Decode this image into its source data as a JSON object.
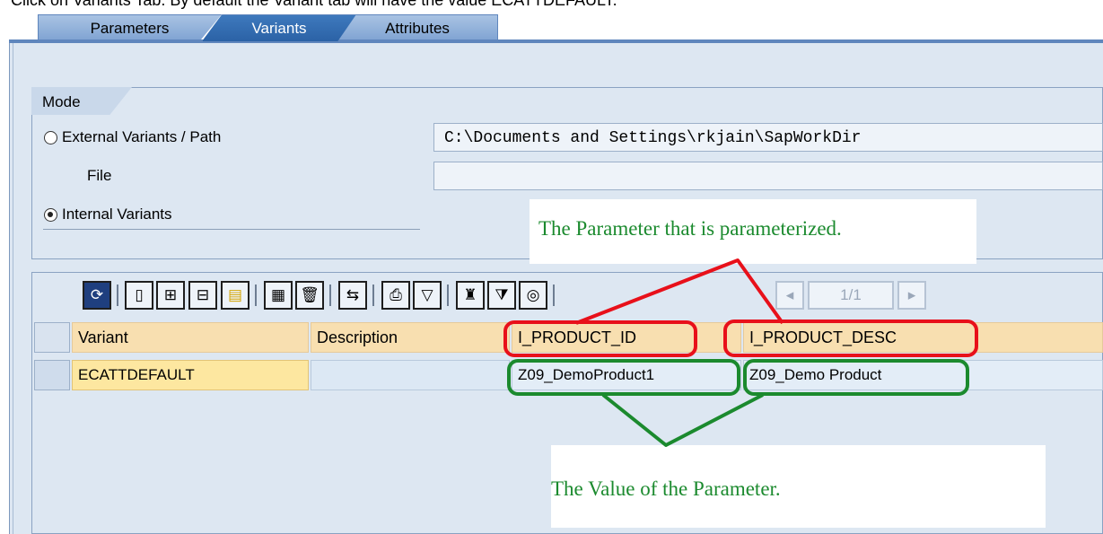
{
  "caption": "Click on Variants Tab. By default the Variant tab will have the value ECATTDEFAULT.",
  "tabs": [
    {
      "label": "Parameters"
    },
    {
      "label": "Variants"
    },
    {
      "label": "Attributes"
    }
  ],
  "mode": {
    "title": "Mode",
    "external_label": "External Variants / Path",
    "path_value": "C:\\Documents and Settings\\rkjain\\SapWorkDir",
    "file_label": "File",
    "file_value": "",
    "internal_label": "Internal Variants",
    "selected": "internal"
  },
  "toolbar": {
    "page_indicator": "1/1"
  },
  "table": {
    "columns": [
      "Variant",
      "Description",
      "I_PRODUCT_ID",
      "I_PRODUCT_DESC"
    ],
    "rows": [
      [
        "ECATTDEFAULT",
        "",
        "Z09_DemoProduct1",
        "Z09_Demo Product"
      ]
    ]
  },
  "annotations": {
    "top": "The Parameter that is parameterized.",
    "bottom": "The Value of the Parameter."
  },
  "colors": {
    "panel_bg": "#dde7f2",
    "header_bg": "#f8dfb0",
    "annotation_red": "#e8101a",
    "annotation_green": "#1b8a2e"
  }
}
